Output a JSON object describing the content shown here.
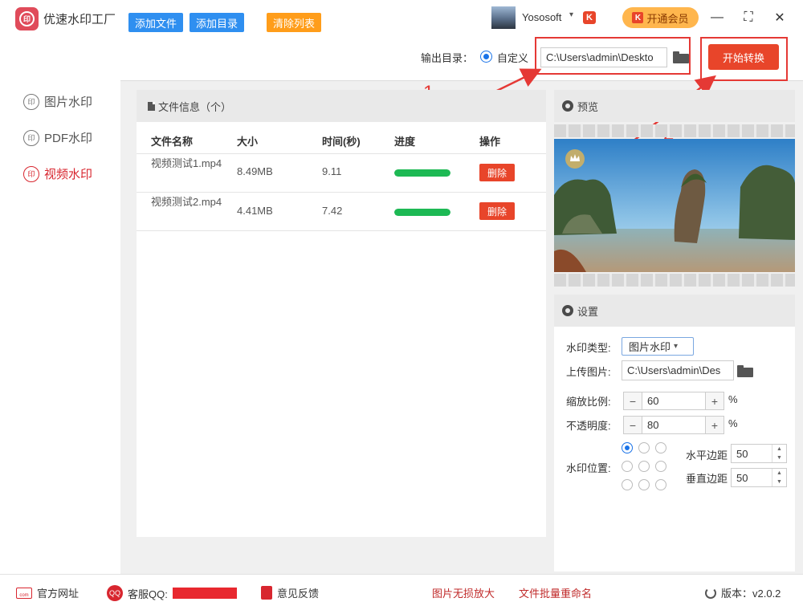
{
  "app": {
    "title": "优速水印工厂",
    "logo_glyph": "印"
  },
  "header": {
    "user_name": "Yososoft",
    "k_badge": "K",
    "vip_label": "开通会员",
    "vip_glyph": "K"
  },
  "window": {
    "min": "—",
    "max": "⛶",
    "close": "✕"
  },
  "sidebar": {
    "items": [
      {
        "label": "图片水印",
        "icon": "image-watermark-icon",
        "active": false
      },
      {
        "label": "PDF水印",
        "icon": "pdf-watermark-icon",
        "active": false
      },
      {
        "label": "视频水印",
        "icon": "video-watermark-icon",
        "active": true
      }
    ]
  },
  "toolbar": {
    "add_file": "添加文件",
    "add_dir": "添加目录",
    "clear_list": "清除列表",
    "output_label": "输出目录：",
    "custom_label": "自定义",
    "output_path": "C:\\Users\\admin\\Deskto",
    "start": "开始转换"
  },
  "annotations": {
    "callout1": "1",
    "callout2": "2"
  },
  "file_panel": {
    "title": "文件信息（个）",
    "columns": {
      "name": "文件名称",
      "size": "大小",
      "time": "时间(秒)",
      "progress": "进度",
      "action": "操作"
    },
    "rows": [
      {
        "name": "视频测试1.mp4",
        "size": "8.49MB",
        "time": "9.11",
        "progress": 1.0,
        "action": "删除"
      },
      {
        "name": "视频测试2.mp4",
        "size": "4.41MB",
        "time": "7.42",
        "progress": 1.0,
        "action": "删除"
      }
    ]
  },
  "preview": {
    "title": "预览"
  },
  "settings": {
    "title": "设置",
    "type_label": "水印类型:",
    "type_value": "图片水印",
    "upload_label": "上传图片:",
    "upload_path": "C:\\Users\\admin\\Des",
    "scale_label": "缩放比例:",
    "scale_value": "60",
    "opacity_label": "不透明度:",
    "opacity_value": "80",
    "percent": "%",
    "position_label": "水印位置:",
    "position_selected": 0,
    "h_margin_label": "水平边距",
    "h_margin_value": "50",
    "v_margin_label": "垂直边距",
    "v_margin_value": "50"
  },
  "footer": {
    "website": "官方网址",
    "qq": "客服QQ:",
    "feedback": "意见反馈",
    "link1": "图片无损放大",
    "link2": "文件批量重命名",
    "version": "版本：v2.0.2"
  },
  "colors": {
    "accent": "#e8452a",
    "blue": "#2f8ff0",
    "orange": "#ff9d1a",
    "progress": "#1db954",
    "callout": "#e53935"
  }
}
